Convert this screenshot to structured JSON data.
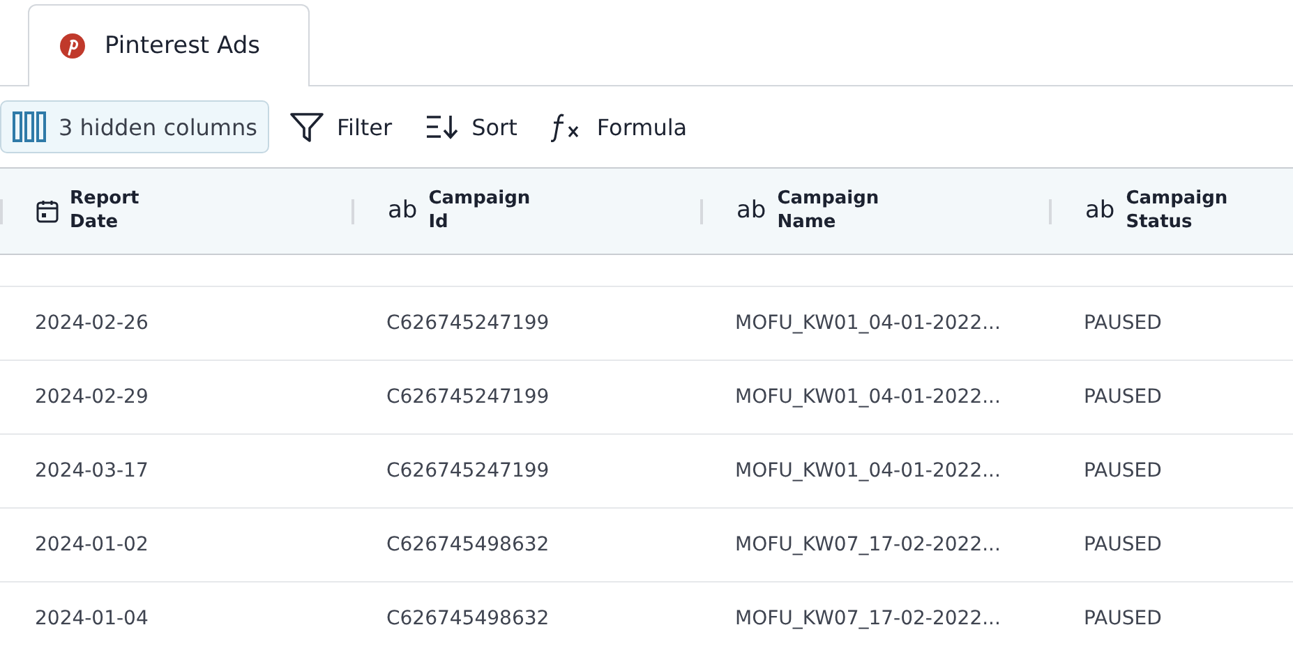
{
  "tabs": [
    {
      "label": "Pinterest Ads",
      "selected": true
    }
  ],
  "toolbar": [
    {
      "kind": "columns",
      "label": "3 hidden columns",
      "active": true
    },
    {
      "kind": "filter",
      "label": "Filter",
      "active": false
    },
    {
      "kind": "sort",
      "label": "Sort",
      "active": false
    },
    {
      "kind": "formula",
      "label": "Formula",
      "active": false
    }
  ],
  "table": {
    "columns": [
      {
        "kind": "date",
        "label": "Report\nDate"
      },
      {
        "kind": "text",
        "icon_text": "ab",
        "label": "Campaign\nId"
      },
      {
        "kind": "text",
        "icon_text": "ab",
        "label": "Campaign\nName"
      },
      {
        "kind": "text",
        "icon_text": "ab",
        "label": "Campaign\nStatus"
      }
    ],
    "rows": [
      [
        "2024-02-26",
        "C626745247199",
        "MOFU_KW01_04-01-2022...",
        "PAUSED"
      ],
      [
        "2024-02-29",
        "C626745247199",
        "MOFU_KW01_04-01-2022...",
        "PAUSED"
      ],
      [
        "2024-03-17",
        "C626745247199",
        "MOFU_KW01_04-01-2022...",
        "PAUSED"
      ],
      [
        "2024-01-02",
        "C626745498632",
        "MOFU_KW07_17-02-2022...",
        "PAUSED"
      ],
      [
        "2024-01-04",
        "C626745498632",
        "MOFU_KW07_17-02-2022...",
        "PAUSED"
      ]
    ]
  }
}
